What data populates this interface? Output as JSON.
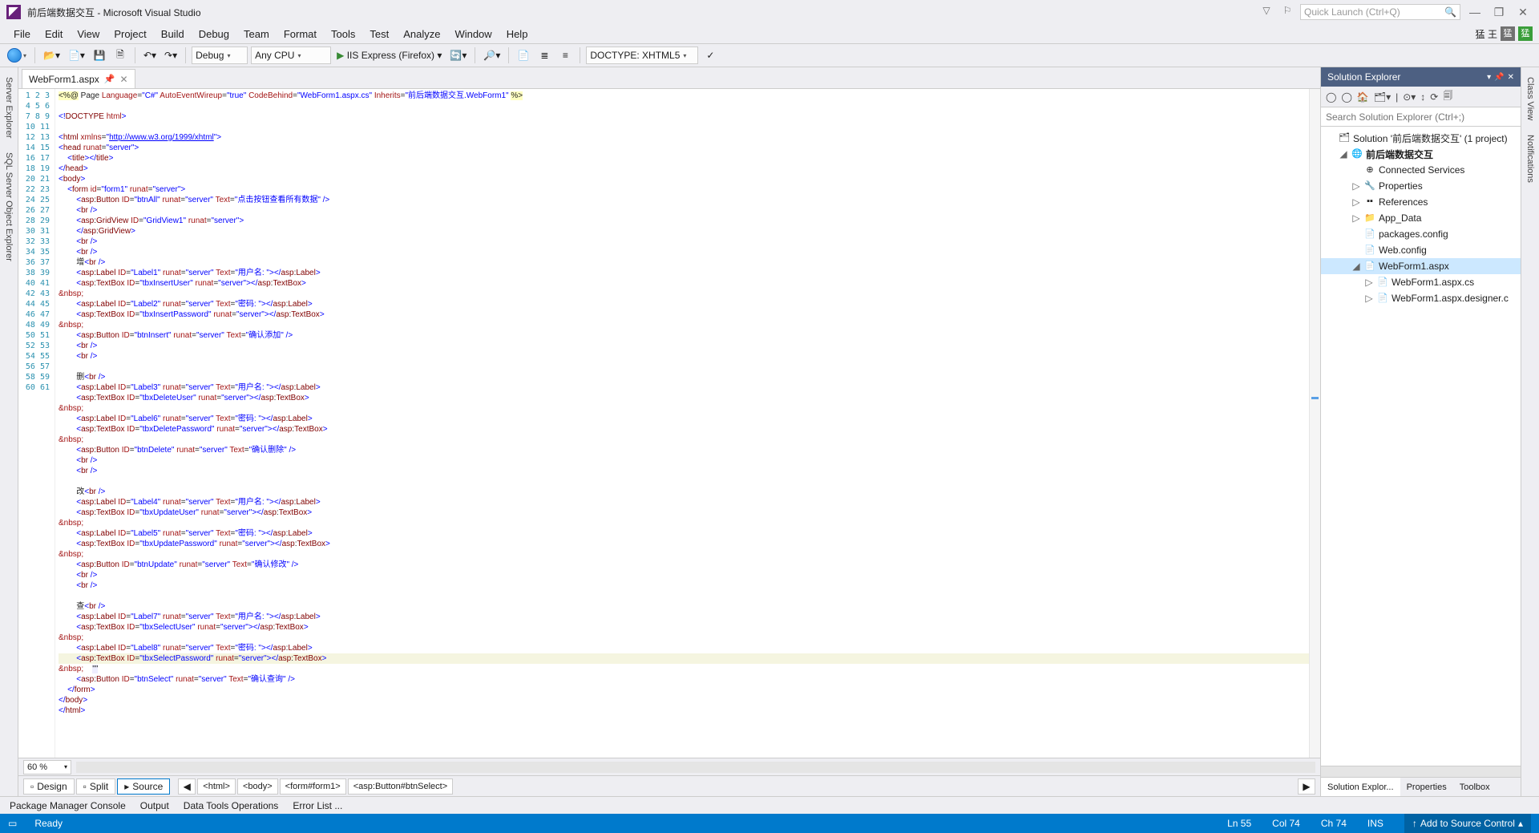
{
  "title": "前后端数据交互 - Microsoft Visual Studio",
  "quick_launch_placeholder": "Quick Launch (Ctrl+Q)",
  "menu": [
    "File",
    "Edit",
    "View",
    "Project",
    "Build",
    "Debug",
    "Team",
    "Format",
    "Tools",
    "Test",
    "Analyze",
    "Window",
    "Help"
  ],
  "menu_right": {
    "name": "猛 王",
    "badge": "猛"
  },
  "toolbar": {
    "config": "Debug",
    "platform": "Any CPU",
    "run": "IIS Express (Firefox)",
    "doctype": "DOCTYPE: XHTML5"
  },
  "left_rails": [
    "Server Explorer",
    "SQL Server Object Explorer"
  ],
  "right_rails": [
    "Class View",
    "Notifications"
  ],
  "tab": {
    "name": "WebForm1.aspx"
  },
  "zoom": "60 %",
  "view_buttons": {
    "design": "Design",
    "split": "Split",
    "source": "Source"
  },
  "breadcrumbs": [
    "<html>",
    "<body>",
    "<form#form1>",
    "<asp:Button#btnSelect>"
  ],
  "bottom_tools": [
    "Package Manager Console",
    "Output",
    "Data Tools Operations",
    "Error List ..."
  ],
  "status": {
    "ready": "Ready",
    "ln": "Ln 55",
    "col": "Col 74",
    "ch": "Ch 74",
    "ins": "INS",
    "add": "Add to Source Control"
  },
  "solution_explorer": {
    "title": "Solution Explorer",
    "search_placeholder": "Search Solution Explorer (Ctrl+;)",
    "root": "Solution '前后端数据交互' (1 project)",
    "project": "前后端数据交互",
    "nodes": [
      "Connected Services",
      "Properties",
      "References",
      "App_Data",
      "packages.config",
      "Web.config",
      "WebForm1.aspx"
    ],
    "children": [
      "WebForm1.aspx.cs",
      "WebForm1.aspx.designer.c"
    ],
    "tabs": [
      "Solution Explor...",
      "Properties",
      "Toolbox"
    ]
  },
  "gutter_lines": 61,
  "code_lines": [
    {
      "hl": true,
      "html": "<span class='hl-yellow'>&lt;%@</span> Page <span class='c-red'>Language</span>=<span class='c-blue'>\"C#\"</span> <span class='c-red'>AutoEventWireup</span>=<span class='c-blue'>\"true\"</span> <span class='c-red'>CodeBehind</span>=<span class='c-blue'>\"WebForm1.aspx.cs\"</span> <span class='c-red'>Inherits</span>=<span class='c-blue'>\"前后端数据交互.WebForm1\"</span> <span class='hl-yellow'>%&gt;</span>"
    },
    {
      "html": ""
    },
    {
      "html": "<span class='c-blue'>&lt;!</span><span class='c-maroon'>DOCTYPE</span> <span class='c-red'>html</span><span class='c-blue'>&gt;</span>"
    },
    {
      "html": ""
    },
    {
      "html": "<span class='c-blue'>&lt;</span><span class='c-maroon'>html</span> <span class='c-red'>xmlns</span>=<span class='c-blue'>\"<u>http://www.w3.org/1999/xhtml</u>\"</span><span class='c-blue'>&gt;</span>"
    },
    {
      "html": "<span class='c-blue'>&lt;</span><span class='c-maroon'>head</span> <span class='c-red'>runat</span>=<span class='c-blue'>\"server\"</span><span class='c-blue'>&gt;</span>"
    },
    {
      "html": "    <span class='c-blue'>&lt;</span><span class='c-maroon'>title</span><span class='c-blue'>&gt;&lt;/</span><span class='c-maroon'>title</span><span class='c-blue'>&gt;</span>"
    },
    {
      "html": "<span class='c-blue'>&lt;/</span><span class='c-maroon'>head</span><span class='c-blue'>&gt;</span>"
    },
    {
      "html": "<span class='c-blue'>&lt;</span><span class='c-maroon'>body</span><span class='c-blue'>&gt;</span>"
    },
    {
      "html": "    <span class='c-blue'>&lt;</span><span class='c-maroon'>form</span> <span class='c-red'>id</span>=<span class='c-blue'>\"form1\"</span> <span class='c-red'>runat</span>=<span class='c-blue'>\"server\"</span><span class='c-blue'>&gt;</span>"
    },
    {
      "html": "        <span class='c-blue'>&lt;</span><span class='c-maroon'>asp</span>:<span class='c-maroon'>Button</span> <span class='c-red'>ID</span>=<span class='c-blue'>\"btnAll\"</span> <span class='c-red'>runat</span>=<span class='c-blue'>\"server\"</span> <span class='c-red'>Text</span>=<span class='c-blue'>\"点击按钮查看所有数据\"</span> <span class='c-blue'>/&gt;</span>"
    },
    {
      "html": "        <span class='c-blue'>&lt;</span><span class='c-maroon'>br</span> <span class='c-blue'>/&gt;</span>"
    },
    {
      "html": "        <span class='c-blue'>&lt;</span><span class='c-maroon'>asp</span>:<span class='c-maroon'>GridView</span> <span class='c-red'>ID</span>=<span class='c-blue'>\"GridView1\"</span> <span class='c-red'>runat</span>=<span class='c-blue'>\"server\"</span><span class='c-blue'>&gt;</span>"
    },
    {
      "html": "        <span class='c-blue'>&lt;/</span><span class='c-maroon'>asp</span>:<span class='c-maroon'>GridView</span><span class='c-blue'>&gt;</span>"
    },
    {
      "html": "        <span class='c-blue'>&lt;</span><span class='c-maroon'>br</span> <span class='c-blue'>/&gt;</span>"
    },
    {
      "html": "        <span class='c-blue'>&lt;</span><span class='c-maroon'>br</span> <span class='c-blue'>/&gt;</span>"
    },
    {
      "html": "        增<span class='c-blue'>&lt;</span><span class='c-maroon'>br</span> <span class='c-blue'>/&gt;</span>"
    },
    {
      "html": "        <span class='c-blue'>&lt;</span><span class='c-maroon'>asp</span>:<span class='c-maroon'>Label</span> <span class='c-red'>ID</span>=<span class='c-blue'>\"Label1\"</span> <span class='c-red'>runat</span>=<span class='c-blue'>\"server\"</span> <span class='c-red'>Text</span>=<span class='c-blue'>\"用户名: \"</span><span class='c-blue'>&gt;&lt;/</span><span class='c-maroon'>asp</span>:<span class='c-maroon'>Label</span><span class='c-blue'>&gt;</span>"
    },
    {
      "html": "        <span class='c-blue'>&lt;</span><span class='c-maroon'>asp</span>:<span class='c-maroon'>TextBox</span> <span class='c-red'>ID</span>=<span class='c-blue'>\"tbxInsertUser\"</span> <span class='c-red'>runat</span>=<span class='c-blue'>\"server\"</span><span class='c-blue'>&gt;&lt;/</span><span class='c-maroon'>asp</span>:<span class='c-maroon'>TextBox</span><span class='c-blue'>&gt;</span>"
    },
    {
      "html": "<span class='c-red'>&amp;nbsp;</span>"
    },
    {
      "html": "        <span class='c-blue'>&lt;</span><span class='c-maroon'>asp</span>:<span class='c-maroon'>Label</span> <span class='c-red'>ID</span>=<span class='c-blue'>\"Label2\"</span> <span class='c-red'>runat</span>=<span class='c-blue'>\"server\"</span> <span class='c-red'>Text</span>=<span class='c-blue'>\"密码: \"</span><span class='c-blue'>&gt;&lt;/</span><span class='c-maroon'>asp</span>:<span class='c-maroon'>Label</span><span class='c-blue'>&gt;</span>"
    },
    {
      "html": "        <span class='c-blue'>&lt;</span><span class='c-maroon'>asp</span>:<span class='c-maroon'>TextBox</span> <span class='c-red'>ID</span>=<span class='c-blue'>\"tbxInsertPassword\"</span> <span class='c-red'>runat</span>=<span class='c-blue'>\"server\"</span><span class='c-blue'>&gt;&lt;/</span><span class='c-maroon'>asp</span>:<span class='c-maroon'>TextBox</span><span class='c-blue'>&gt;</span>"
    },
    {
      "html": "<span class='c-red'>&amp;nbsp;</span>"
    },
    {
      "html": "        <span class='c-blue'>&lt;</span><span class='c-maroon'>asp</span>:<span class='c-maroon'>Button</span> <span class='c-red'>ID</span>=<span class='c-blue'>\"btnInsert\"</span> <span class='c-red'>runat</span>=<span class='c-blue'>\"server\"</span> <span class='c-red'>Text</span>=<span class='c-blue'>\"确认添加\"</span> <span class='c-blue'>/&gt;</span>"
    },
    {
      "html": "        <span class='c-blue'>&lt;</span><span class='c-maroon'>br</span> <span class='c-blue'>/&gt;</span>"
    },
    {
      "html": "        <span class='c-blue'>&lt;</span><span class='c-maroon'>br</span> <span class='c-blue'>/&gt;</span>"
    },
    {
      "html": "        "
    },
    {
      "html": "        删<span class='c-blue'>&lt;</span><span class='c-maroon'>br</span> <span class='c-blue'>/&gt;</span>"
    },
    {
      "html": "        <span class='c-blue'>&lt;</span><span class='c-maroon'>asp</span>:<span class='c-maroon'>Label</span> <span class='c-red'>ID</span>=<span class='c-blue'>\"Label3\"</span> <span class='c-red'>runat</span>=<span class='c-blue'>\"server\"</span> <span class='c-red'>Text</span>=<span class='c-blue'>\"用户名: \"</span><span class='c-blue'>&gt;&lt;/</span><span class='c-maroon'>asp</span>:<span class='c-maroon'>Label</span><span class='c-blue'>&gt;</span>"
    },
    {
      "html": "        <span class='c-blue'>&lt;</span><span class='c-maroon'>asp</span>:<span class='c-maroon'>TextBox</span> <span class='c-red'>ID</span>=<span class='c-blue'>\"tbxDeleteUser\"</span> <span class='c-red'>runat</span>=<span class='c-blue'>\"server\"</span><span class='c-blue'>&gt;&lt;/</span><span class='c-maroon'>asp</span>:<span class='c-maroon'>TextBox</span><span class='c-blue'>&gt;</span>"
    },
    {
      "html": "<span class='c-red'>&amp;nbsp;</span>"
    },
    {
      "html": "        <span class='c-blue'>&lt;</span><span class='c-maroon'>asp</span>:<span class='c-maroon'>Label</span> <span class='c-red'>ID</span>=<span class='c-blue'>\"Label6\"</span> <span class='c-red'>runat</span>=<span class='c-blue'>\"server\"</span> <span class='c-red'>Text</span>=<span class='c-blue'>\"密码: \"</span><span class='c-blue'>&gt;&lt;/</span><span class='c-maroon'>asp</span>:<span class='c-maroon'>Label</span><span class='c-blue'>&gt;</span>"
    },
    {
      "html": "        <span class='c-blue'>&lt;</span><span class='c-maroon'>asp</span>:<span class='c-maroon'>TextBox</span> <span class='c-red'>ID</span>=<span class='c-blue'>\"tbxDeletePassword\"</span> <span class='c-red'>runat</span>=<span class='c-blue'>\"server\"</span><span class='c-blue'>&gt;&lt;/</span><span class='c-maroon'>asp</span>:<span class='c-maroon'>TextBox</span><span class='c-blue'>&gt;</span>"
    },
    {
      "html": "<span class='c-red'>&amp;nbsp;</span>"
    },
    {
      "html": "        <span class='c-blue'>&lt;</span><span class='c-maroon'>asp</span>:<span class='c-maroon'>Button</span> <span class='c-red'>ID</span>=<span class='c-blue'>\"btnDelete\"</span> <span class='c-red'>runat</span>=<span class='c-blue'>\"server\"</span> <span class='c-red'>Text</span>=<span class='c-blue'>\"确认删除\"</span> <span class='c-blue'>/&gt;</span>"
    },
    {
      "html": "        <span class='c-blue'>&lt;</span><span class='c-maroon'>br</span> <span class='c-blue'>/&gt;</span>"
    },
    {
      "html": "        <span class='c-blue'>&lt;</span><span class='c-maroon'>br</span> <span class='c-blue'>/&gt;</span>"
    },
    {
      "html": "        "
    },
    {
      "html": "        改<span class='c-blue'>&lt;</span><span class='c-maroon'>br</span> <span class='c-blue'>/&gt;</span>"
    },
    {
      "html": "        <span class='c-blue'>&lt;</span><span class='c-maroon'>asp</span>:<span class='c-maroon'>Label</span> <span class='c-red'>ID</span>=<span class='c-blue'>\"Label4\"</span> <span class='c-red'>runat</span>=<span class='c-blue'>\"server\"</span> <span class='c-red'>Text</span>=<span class='c-blue'>\"用户名: \"</span><span class='c-blue'>&gt;&lt;/</span><span class='c-maroon'>asp</span>:<span class='c-maroon'>Label</span><span class='c-blue'>&gt;</span>"
    },
    {
      "html": "        <span class='c-blue'>&lt;</span><span class='c-maroon'>asp</span>:<span class='c-maroon'>TextBox</span> <span class='c-red'>ID</span>=<span class='c-blue'>\"tbxUpdateUser\"</span> <span class='c-red'>runat</span>=<span class='c-blue'>\"server\"</span><span class='c-blue'>&gt;&lt;/</span><span class='c-maroon'>asp</span>:<span class='c-maroon'>TextBox</span><span class='c-blue'>&gt;</span>"
    },
    {
      "html": "<span class='c-red'>&amp;nbsp;</span>"
    },
    {
      "html": "        <span class='c-blue'>&lt;</span><span class='c-maroon'>asp</span>:<span class='c-maroon'>Label</span> <span class='c-red'>ID</span>=<span class='c-blue'>\"Label5\"</span> <span class='c-red'>runat</span>=<span class='c-blue'>\"server\"</span> <span class='c-red'>Text</span>=<span class='c-blue'>\"密码: \"</span><span class='c-blue'>&gt;&lt;/</span><span class='c-maroon'>asp</span>:<span class='c-maroon'>Label</span><span class='c-blue'>&gt;</span>"
    },
    {
      "html": "        <span class='c-blue'>&lt;</span><span class='c-maroon'>asp</span>:<span class='c-maroon'>TextBox</span> <span class='c-red'>ID</span>=<span class='c-blue'>\"tbxUpdatePassword\"</span> <span class='c-red'>runat</span>=<span class='c-blue'>\"server\"</span><span class='c-blue'>&gt;&lt;/</span><span class='c-maroon'>asp</span>:<span class='c-maroon'>TextBox</span><span class='c-blue'>&gt;</span>"
    },
    {
      "html": "<span class='c-red'>&amp;nbsp;</span>"
    },
    {
      "html": "        <span class='c-blue'>&lt;</span><span class='c-maroon'>asp</span>:<span class='c-maroon'>Button</span> <span class='c-red'>ID</span>=<span class='c-blue'>\"btnUpdate\"</span> <span class='c-red'>runat</span>=<span class='c-blue'>\"server\"</span> <span class='c-red'>Text</span>=<span class='c-blue'>\"确认修改\"</span> <span class='c-blue'>/&gt;</span>"
    },
    {
      "html": "        <span class='c-blue'>&lt;</span><span class='c-maroon'>br</span> <span class='c-blue'>/&gt;</span>"
    },
    {
      "html": "        <span class='c-blue'>&lt;</span><span class='c-maroon'>br</span> <span class='c-blue'>/&gt;</span>"
    },
    {
      "html": "        "
    },
    {
      "html": "        查<span class='c-blue'>&lt;</span><span class='c-maroon'>br</span> <span class='c-blue'>/&gt;</span>"
    },
    {
      "html": "        <span class='c-blue'>&lt;</span><span class='c-maroon'>asp</span>:<span class='c-maroon'>Label</span> <span class='c-red'>ID</span>=<span class='c-blue'>\"Label7\"</span> <span class='c-red'>runat</span>=<span class='c-blue'>\"server\"</span> <span class='c-red'>Text</span>=<span class='c-blue'>\"用户名: \"</span><span class='c-blue'>&gt;&lt;/</span><span class='c-maroon'>asp</span>:<span class='c-maroon'>Label</span><span class='c-blue'>&gt;</span>"
    },
    {
      "html": "        <span class='c-blue'>&lt;</span><span class='c-maroon'>asp</span>:<span class='c-maroon'>TextBox</span> <span class='c-red'>ID</span>=<span class='c-blue'>\"tbxSelectUser\"</span> <span class='c-red'>runat</span>=<span class='c-blue'>\"server\"</span><span class='c-blue'>&gt;&lt;/</span><span class='c-maroon'>asp</span>:<span class='c-maroon'>TextBox</span><span class='c-blue'>&gt;</span>"
    },
    {
      "html": "<span class='c-red'>&amp;nbsp;</span>"
    },
    {
      "html": "        <span class='c-blue'>&lt;</span><span class='c-maroon'>asp</span>:<span class='c-maroon'>Label</span> <span class='c-red'>ID</span>=<span class='c-blue'>\"Label8\"</span> <span class='c-red'>runat</span>=<span class='c-blue'>\"server\"</span> <span class='c-red'>Text</span>=<span class='c-blue'>\"密码: \"</span><span class='c-blue'>&gt;&lt;/</span><span class='c-maroon'>asp</span>:<span class='c-maroon'>Label</span><span class='c-blue'>&gt;</span>"
    },
    {
      "hl_line": true,
      "html": "        <span class='c-blue'>&lt;</span><span class='c-maroon'>asp</span>:<span class='c-maroon'>TextBox</span> <span class='c-red'>ID</span>=<span class='c-blue'>\"tbxSelectPassword\"</span> <span class='c-red'>runat</span>=<span class='c-blue'>\"server\"</span><span class='c-blue'>&gt;&lt;/</span><span class='c-maroon'>asp</span>:<span class='c-maroon'>TextBox</span><span class='c-blue'>&gt;</span>"
    },
    {
      "html": "<span class='c-red'>&amp;nbsp;</span>    <span style='background:#eef;'>\"\"</span>"
    },
    {
      "html": "        <span class='c-blue'>&lt;</span><span class='c-maroon'>asp</span>:<span class='c-maroon'>Button</span> <span class='c-red'>ID</span>=<span class='c-blue'>\"btnSelect\"</span> <span class='c-red'>runat</span>=<span class='c-blue'>\"server\"</span> <span class='c-red'>Text</span>=<span class='c-blue'>\"确认查询\"</span> <span class='c-blue'>/&gt;</span>"
    },
    {
      "html": "    <span class='c-blue'>&lt;/</span><span class='c-maroon'>form</span><span class='c-blue'>&gt;</span>"
    },
    {
      "html": "<span class='c-blue'>&lt;/</span><span class='c-maroon'>body</span><span class='c-blue'>&gt;</span>"
    },
    {
      "html": "<span class='c-blue'>&lt;/</span><span class='c-maroon'>html</span><span class='c-blue'>&gt;</span>"
    },
    {
      "html": ""
    }
  ]
}
